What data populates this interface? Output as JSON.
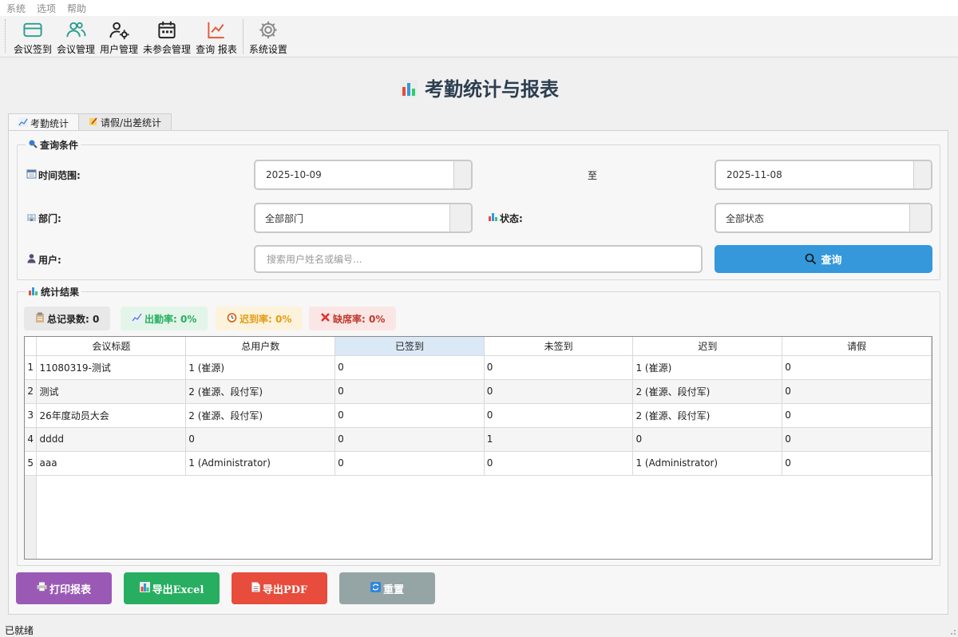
{
  "menubar": {
    "items": [
      "系统",
      "选项",
      "帮助"
    ]
  },
  "toolbar": {
    "buttons": [
      {
        "label": "会议签到",
        "icon": "card-icon",
        "color": "#2a9d8f"
      },
      {
        "label": "会议管理",
        "icon": "users-icon",
        "color": "#2a9d8f"
      },
      {
        "label": "用户管理",
        "icon": "user-gear-icon",
        "color": "#222222"
      },
      {
        "label": "未参会管理",
        "icon": "calendar-icon",
        "color": "#222222"
      },
      {
        "label": "查询 报表",
        "icon": "chart-line-icon",
        "color": "#e05a3a"
      },
      {
        "label": "系统设置",
        "icon": "gear-icon",
        "color": "#888888"
      }
    ]
  },
  "page": {
    "title": "考勤统计与报表"
  },
  "tabs": [
    {
      "label": "考勤统计",
      "active": true
    },
    {
      "label": "请假/出差统计",
      "active": false
    }
  ],
  "query": {
    "group_title": "查询条件",
    "time_label": "时间范围:",
    "date_from": "2025-10-09",
    "to_label": "至",
    "date_to": "2025-11-08",
    "dept_label": "部门:",
    "dept_value": "全部部门",
    "status_label": "状态:",
    "status_value": "全部状态",
    "user_label": "用户:",
    "search_placeholder": "搜索用户姓名或编号...",
    "query_button": "查询"
  },
  "results": {
    "group_title": "统计结果",
    "stats": [
      {
        "label": "总记录数: 0",
        "bg": "#e8e8e8",
        "fg": "#222222"
      },
      {
        "label": "出勤率: 0%",
        "bg": "#e3f5e9",
        "fg": "#27ae60"
      },
      {
        "label": "迟到率: 0%",
        "bg": "#fdf3dc",
        "fg": "#e69a12"
      },
      {
        "label": "缺席率: 0%",
        "bg": "#fbe6e6",
        "fg": "#c0392b"
      }
    ],
    "columns": [
      "会议标题",
      "总用户数",
      "已签到",
      "未签到",
      "迟到",
      "请假"
    ],
    "rows": [
      {
        "n": "1",
        "cells": [
          "11080319-测试",
          "1 (崔源)",
          "0",
          "0",
          "1 (崔源)",
          "0"
        ]
      },
      {
        "n": "2",
        "cells": [
          "测试",
          "2 (崔源、段付军)",
          "0",
          "0",
          "2 (崔源、段付军)",
          "0"
        ]
      },
      {
        "n": "3",
        "cells": [
          "26年度动员大会",
          "2 (崔源、段付军)",
          "0",
          "0",
          "2 (崔源、段付军)",
          "0"
        ]
      },
      {
        "n": "4",
        "cells": [
          "dddd",
          "0",
          "0",
          "1",
          "0",
          "0"
        ]
      },
      {
        "n": "5",
        "cells": [
          "aaa",
          "1 (Administrator)",
          "0",
          "0",
          "1 (Administrator)",
          "0"
        ]
      }
    ]
  },
  "actions": [
    {
      "label": "打印报表",
      "bg": "#9b59b6"
    },
    {
      "label": "导出Excel",
      "bg": "#27ae60"
    },
    {
      "label": "导出PDF",
      "bg": "#e74c3c"
    },
    {
      "label": "重置",
      "bg": "#95a5a6"
    }
  ],
  "status": {
    "text": "已就绪"
  }
}
